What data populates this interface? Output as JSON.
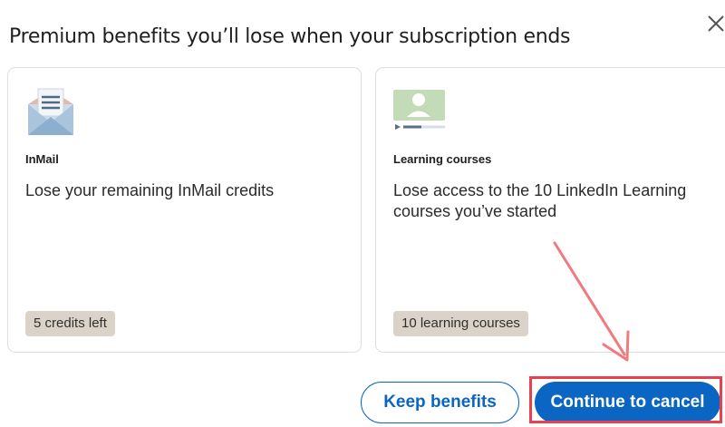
{
  "dialog": {
    "title": "Premium benefits you’ll lose when your subscription ends",
    "close_icon": "close-icon"
  },
  "cards": [
    {
      "icon": "envelope-icon",
      "heading": "InMail",
      "description": "Lose your remaining InMail credits",
      "badge": "5 credits left"
    },
    {
      "icon": "video-course-icon",
      "heading": "Learning courses",
      "description": "Lose access to the 10 LinkedIn Learning courses you’ve started",
      "badge": "10 learning courses"
    }
  ],
  "actions": {
    "keep_label": "Keep benefits",
    "cancel_label": "Continue to cancel"
  },
  "colors": {
    "primary": "#0a66c2",
    "badge_bg": "#dcd3c8",
    "annotation": "#ea3f4d"
  }
}
